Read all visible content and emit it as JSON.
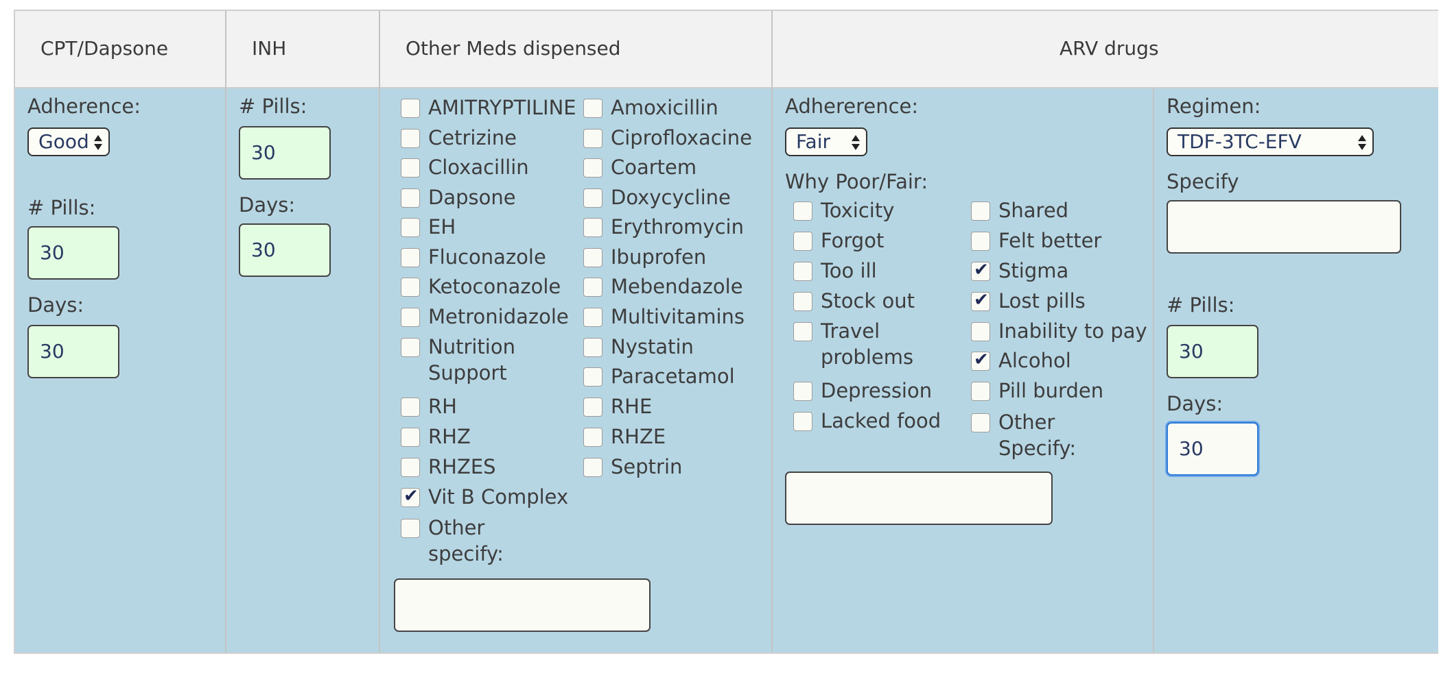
{
  "headers": {
    "cpt": "CPT/Dapsone",
    "inh": "INH",
    "other_meds": "Other Meds dispensed",
    "arv": "ARV drugs"
  },
  "cpt": {
    "adherence_label": "Adherence:",
    "adherence_value": "Good",
    "pills_label": "# Pills:",
    "pills_value": "30",
    "days_label": "Days:",
    "days_value": "30"
  },
  "inh": {
    "pills_label": "# Pills:",
    "pills_value": "30",
    "days_label": "Days:",
    "days_value": "30"
  },
  "other_meds": {
    "left": [
      {
        "label": "AMITRYPTILINE",
        "checked": false
      },
      {
        "label": "Cetrizine",
        "checked": false
      },
      {
        "label": "Cloxacillin",
        "checked": false
      },
      {
        "label": "Dapsone",
        "checked": false
      },
      {
        "label": "EH",
        "checked": false
      },
      {
        "label": "Fluconazole",
        "checked": false
      },
      {
        "label": "Ketoconazole",
        "checked": false
      },
      {
        "label": "Metronidazole",
        "checked": false
      },
      {
        "label": "Nutrition",
        "label2": "Support",
        "checked": false
      },
      {
        "label": "RH",
        "checked": false
      },
      {
        "label": "RHZ",
        "checked": false
      },
      {
        "label": "RHZES",
        "checked": false
      },
      {
        "label": "Vit B Complex",
        "checked": true
      },
      {
        "label": "Other",
        "label2": "specify:",
        "checked": false
      }
    ],
    "right": [
      {
        "label": "Amoxicillin",
        "checked": false
      },
      {
        "label": "Ciprofloxacine",
        "checked": false
      },
      {
        "label": "Coartem",
        "checked": false
      },
      {
        "label": "Doxycycline",
        "checked": false
      },
      {
        "label": "Erythromycin",
        "checked": false
      },
      {
        "label": "Ibuprofen",
        "checked": false
      },
      {
        "label": "Mebendazole",
        "checked": false
      },
      {
        "label": "Multivitamins",
        "checked": false
      },
      {
        "label": "Nystatin",
        "checked": false
      },
      {
        "label": "Paracetamol",
        "checked": false
      },
      {
        "label": "RHE",
        "checked": false
      },
      {
        "label": "RHZE",
        "checked": false
      },
      {
        "label": "Septrin",
        "checked": false
      }
    ],
    "other_value": ""
  },
  "arv": {
    "adherence_label": "Adhererence:",
    "adherence_value": "Fair",
    "why_label": "Why Poor/Fair:",
    "reasons_left": [
      {
        "label": "Toxicity",
        "checked": false
      },
      {
        "label": "Forgot",
        "checked": false
      },
      {
        "label": "Too ill",
        "checked": false
      },
      {
        "label": "Stock out",
        "checked": false
      },
      {
        "label": "Travel",
        "label2": "problems",
        "checked": false
      },
      {
        "label": "Depression",
        "checked": false
      },
      {
        "label": "Lacked food",
        "checked": false
      }
    ],
    "reasons_right": [
      {
        "label": "Shared",
        "checked": false
      },
      {
        "label": "Felt better",
        "checked": false
      },
      {
        "label": "Stigma",
        "checked": true
      },
      {
        "label": "Lost pills",
        "checked": true
      },
      {
        "label": "Inability to pay",
        "checked": false
      },
      {
        "label": "Alcohol",
        "checked": true
      },
      {
        "label": "Pill burden",
        "checked": false
      },
      {
        "label": "Other",
        "label2": "Specify:",
        "checked": false
      }
    ],
    "other_value": "",
    "regimen_label": "Regimen:",
    "regimen_value": "TDF-3TC-EFV",
    "specify_label": "Specify",
    "specify_value": "",
    "pills_label": "# Pills:",
    "pills_value": "30",
    "days_label": "Days:",
    "days_value": "30"
  }
}
